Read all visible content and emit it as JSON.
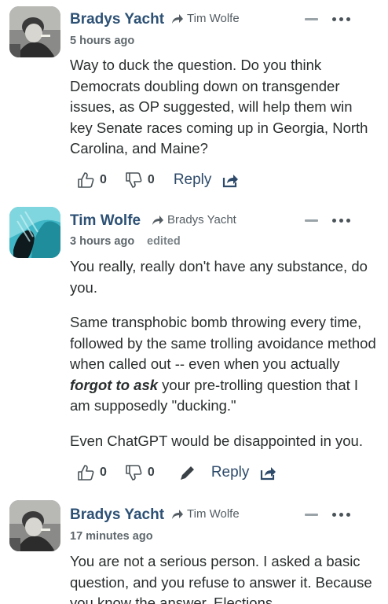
{
  "comments": [
    {
      "author": "Bradys Yacht",
      "reply_to": "Tim Wolfe",
      "time": "5 hours ago",
      "edited": "",
      "paragraphs": [
        "Way to duck the question. Do you think Democrats doubling down on transgender issues, as OP suggested, will help them win key Senate races coming up in Georgia, North Carolina, and Maine?"
      ],
      "upvotes": "0",
      "downvotes": "0",
      "reply_label": "Reply"
    },
    {
      "author": "Tim Wolfe",
      "reply_to": "Bradys Yacht",
      "time": "3 hours ago",
      "edited": "edited",
      "paragraph1": "You really, really don't have any substance, do you.",
      "paragraph2_pre": "Same transphobic bomb throwing every time, followed by the same trolling avoidance method when called out -- even when you actually ",
      "paragraph2_em": "forgot to ask",
      "paragraph2_post": " your pre-trolling question that I am supposedly \"ducking.\"",
      "paragraph3": "Even ChatGPT would be disappointed in you.",
      "upvotes": "0",
      "downvotes": "0",
      "reply_label": "Reply"
    },
    {
      "author": "Bradys Yacht",
      "reply_to": "Tim Wolfe",
      "time": "17 minutes ago",
      "paragraph1": "You are not a serious person. I asked a basic question, and you refuse to answer it. Because you know the answer. Elections"
    }
  ],
  "icons": {
    "reply_arrow": "share-arrow-icon",
    "collapse": "minus-icon",
    "menu": "more-dots-icon",
    "upvote": "thumbs-up-icon",
    "downvote": "thumbs-down-icon",
    "edit": "pencil-icon",
    "share": "share-icon"
  },
  "colors": {
    "author": "#2d5175",
    "text": "#2a2e2e",
    "meta": "#5e676c"
  }
}
